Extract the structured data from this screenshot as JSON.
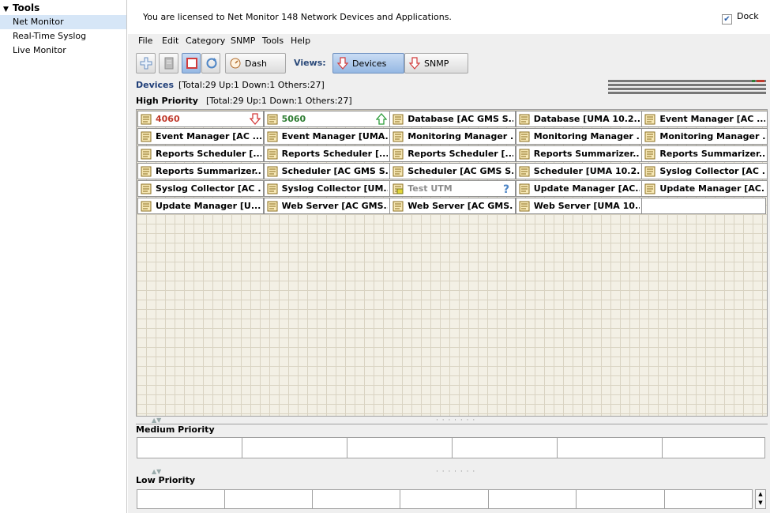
{
  "sidebar": {
    "root_label": "Tools",
    "items": [
      {
        "label": "Net Monitor",
        "selected": true
      },
      {
        "label": "Real-Time Syslog",
        "selected": false
      },
      {
        "label": "Live Monitor",
        "selected": false
      }
    ]
  },
  "license": {
    "text": "You are licensed to Net Monitor 148 Network Devices and Applications.",
    "dock_label": "Dock",
    "dock_checked": true
  },
  "menu": [
    "File",
    "Edit",
    "Category",
    "SNMP",
    "Tools",
    "Help"
  ],
  "toolbar": {
    "dash_label": "Dash",
    "views_label": "Views:",
    "devices_label": "Devices",
    "snmp_label": "SNMP"
  },
  "devices_bar": {
    "title": "Devices",
    "stats": "[Total:29  Up:1  Down:1  Others:27]"
  },
  "high_priority": {
    "title": "High Priority",
    "stats": "[Total:29  Up:1  Down:1  Others:27]",
    "tiles": [
      {
        "label": "4060",
        "status": "down"
      },
      {
        "label": "5060",
        "status": "up"
      },
      {
        "label": "Database [AC GMS S...",
        "status": "none"
      },
      {
        "label": "Database [UMA 10.2...",
        "status": "none"
      },
      {
        "label": "Event Manager [AC ...",
        "status": "none"
      },
      {
        "label": "Event Manager [AC ...",
        "status": "none"
      },
      {
        "label": "Event Manager [UMA...",
        "status": "none"
      },
      {
        "label": "Monitoring Manager ...",
        "status": "none"
      },
      {
        "label": "Monitoring Manager ...",
        "status": "none"
      },
      {
        "label": "Monitoring Manager ...",
        "status": "none"
      },
      {
        "label": "Reports Scheduler [...",
        "status": "none"
      },
      {
        "label": "Reports Scheduler [...",
        "status": "none"
      },
      {
        "label": "Reports Scheduler [...",
        "status": "none"
      },
      {
        "label": "Reports Summarizer...",
        "status": "none"
      },
      {
        "label": "Reports Summarizer...",
        "status": "none"
      },
      {
        "label": "Reports Summarizer...",
        "status": "none"
      },
      {
        "label": "Scheduler [AC GMS S...",
        "status": "none"
      },
      {
        "label": "Scheduler [AC GMS S...",
        "status": "none"
      },
      {
        "label": "Scheduler [UMA 10.2...",
        "status": "none"
      },
      {
        "label": "Syslog Collector [AC ...",
        "status": "none"
      },
      {
        "label": "Syslog Collector [AC ...",
        "status": "none"
      },
      {
        "label": "Syslog Collector [UM...",
        "status": "none"
      },
      {
        "label": "Test UTM",
        "status": "unknown"
      },
      {
        "label": "Update Manager [AC...",
        "status": "none"
      },
      {
        "label": "Update Manager [AC...",
        "status": "none"
      },
      {
        "label": "Update Manager [U...",
        "status": "none"
      },
      {
        "label": "Web Server [AC GMS...",
        "status": "none"
      },
      {
        "label": "Web Server [AC GMS...",
        "status": "none"
      },
      {
        "label": "Web Server [UMA 10...",
        "status": "none"
      }
    ]
  },
  "medium_priority": {
    "title": "Medium Priority"
  },
  "low_priority": {
    "title": "Low Priority"
  },
  "colors": {
    "down": "#c0392b",
    "up": "#2e7d32",
    "unknown": "#8c8c8c",
    "selected_bg": "#d6e6f7"
  }
}
